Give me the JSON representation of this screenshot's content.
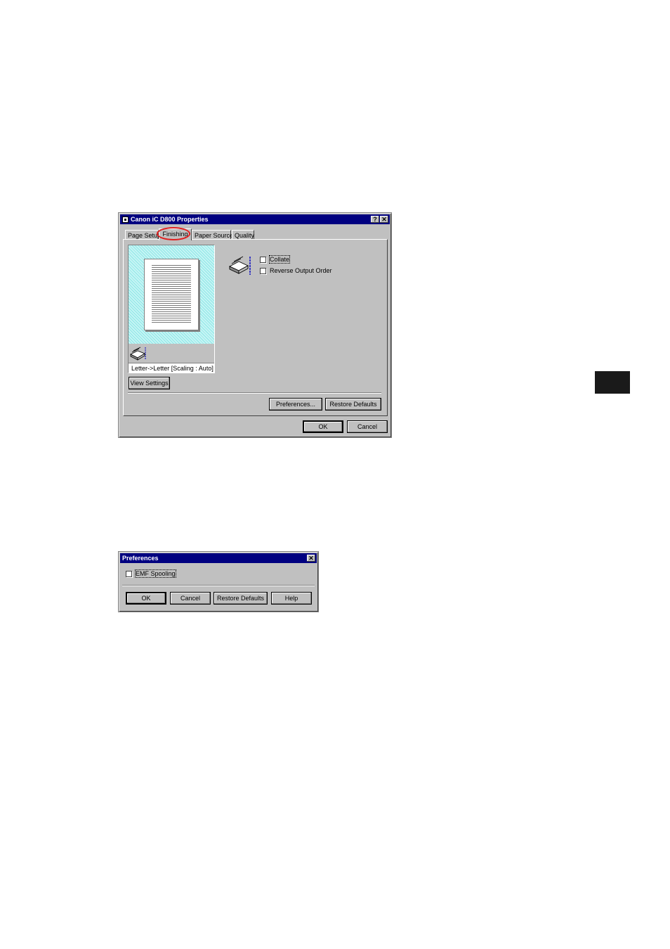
{
  "colors": {
    "titlebar": "#000080",
    "face": "#c0c0c0",
    "highlight_oval": "#e02020",
    "preview_bg": "#8fe6e6"
  },
  "properties_dialog": {
    "title": "Canon iC D800 Properties",
    "help_button": "?",
    "close_button": "✕",
    "tabs": [
      {
        "label": "Page Setup",
        "active": false
      },
      {
        "label": "Finishing",
        "active": true
      },
      {
        "label": "Paper Source",
        "active": false
      },
      {
        "label": "Quality",
        "active": false
      }
    ],
    "preview_status": "Letter->Letter [Scaling : Auto]",
    "view_settings_label": "View Settings",
    "collate_label": "Collate",
    "reverse_output_label": "Reverse Output Order",
    "collate_checked": false,
    "reverse_checked": false,
    "preferences_label": "Preferences...",
    "restore_defaults_label": "Restore Defaults",
    "ok_label": "OK",
    "cancel_label": "Cancel",
    "icons": {
      "title": "printer-app-icon",
      "preview": "printer-icon",
      "finishing": "printer-icon"
    }
  },
  "preferences_dialog": {
    "title": "Preferences",
    "close_button": "✕",
    "emf_label": "EMF Spooling",
    "emf_checked": false,
    "ok_label": "OK",
    "cancel_label": "Cancel",
    "restore_defaults_label": "Restore Defaults",
    "help_label": "Help"
  }
}
